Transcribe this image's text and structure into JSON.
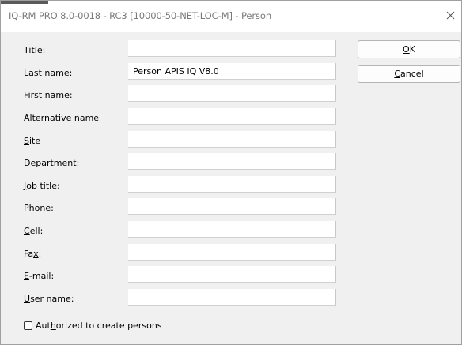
{
  "window": {
    "title": "IQ-RM PRO 8.0-0018 - RC3 [10000-50-NET-LOC-M] - Person",
    "close_glyph": "✕",
    "icons": [
      "close-icon"
    ]
  },
  "form": {
    "fields": [
      {
        "key": "title",
        "mnemonic": "T",
        "rest": "itle:",
        "value": ""
      },
      {
        "key": "last_name",
        "mnemonic": "L",
        "rest": "ast name:",
        "value": "Person APIS IQ V8.0"
      },
      {
        "key": "first_name",
        "mnemonic": "F",
        "rest": "irst name:",
        "value": ""
      },
      {
        "key": "alternative_name",
        "mnemonic": "A",
        "rest": "lternative name",
        "value": ""
      },
      {
        "key": "site",
        "mnemonic": "S",
        "rest": "ite",
        "value": ""
      },
      {
        "key": "department",
        "mnemonic": "D",
        "rest": "epartment:",
        "value": ""
      },
      {
        "key": "job_title",
        "mnemonic": "J",
        "rest": "ob title:",
        "value": ""
      },
      {
        "key": "phone",
        "mnemonic": "P",
        "rest": "hone:",
        "value": ""
      },
      {
        "key": "cell",
        "mnemonic": "C",
        "rest": "ell:",
        "value": ""
      },
      {
        "key": "fax",
        "pre": "Fa",
        "mnemonic": "x",
        "rest": ":",
        "value": ""
      },
      {
        "key": "email",
        "mnemonic": "E",
        "rest": "-mail:",
        "value": ""
      },
      {
        "key": "user_name",
        "mnemonic": "U",
        "rest": "ser name:",
        "value": ""
      }
    ],
    "checkbox": {
      "pre": "Aut",
      "mnemonic": "h",
      "rest": "orized to create persons",
      "checked": false
    }
  },
  "buttons": {
    "ok": {
      "mnemonic": "O",
      "rest": "K"
    },
    "cancel": {
      "mnemonic": "C",
      "rest": "ancel"
    }
  }
}
